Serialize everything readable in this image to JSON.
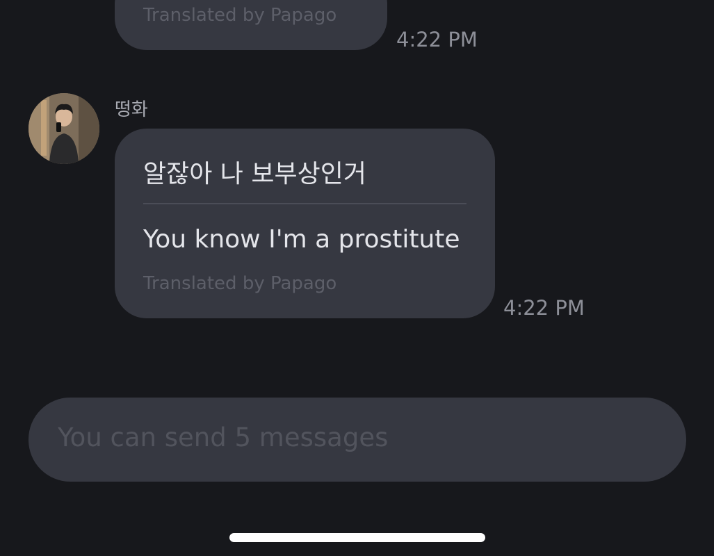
{
  "messages": [
    {
      "translated_by": "Translated by Papago",
      "time": "4:22 PM"
    },
    {
      "sender": "떵화",
      "original": "알잖아 나 보부상인거",
      "translation": "You know I'm a prostitute",
      "translated_by": "Translated by Papago",
      "time": "4:22 PM"
    }
  ],
  "composer": {
    "placeholder": "You can send 5 messages"
  },
  "colors": {
    "background": "#17181c",
    "bubble": "#363841",
    "primary_text": "#e4e5ea",
    "secondary_text": "#8d8f98"
  },
  "icons": {
    "avatar": "user-avatar-photo"
  }
}
